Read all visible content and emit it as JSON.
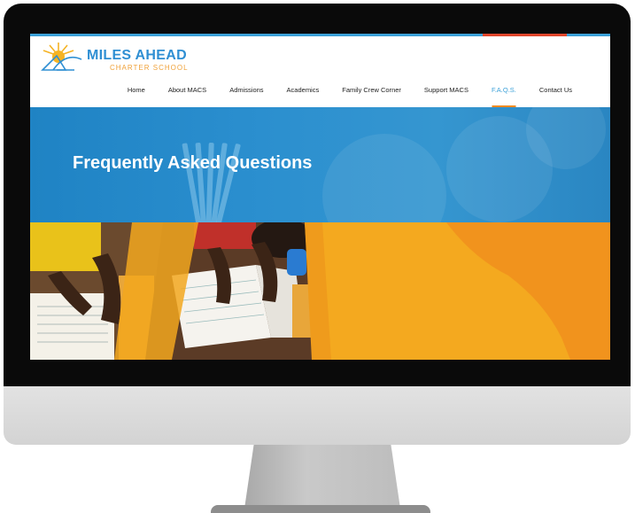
{
  "logo": {
    "title": "MILES AHEAD",
    "subtitle": "CHARTER SCHOOL"
  },
  "nav": {
    "items": [
      {
        "label": "Home",
        "active": false
      },
      {
        "label": "About MACS",
        "active": false
      },
      {
        "label": "Admissions",
        "active": false
      },
      {
        "label": "Academics",
        "active": false
      },
      {
        "label": "Family Crew Corner",
        "active": false
      },
      {
        "label": "Support MACS",
        "active": false
      },
      {
        "label": "F.A.Q.S.",
        "active": true
      },
      {
        "label": "Contact Us",
        "active": false
      }
    ]
  },
  "hero": {
    "title": "Frequently Asked Questions"
  },
  "colors": {
    "brand_blue": "#2f8fd3",
    "brand_orange": "#f08a1c",
    "hero_blue": "#2b8fcf",
    "photo_orange": "#f2a71e"
  }
}
